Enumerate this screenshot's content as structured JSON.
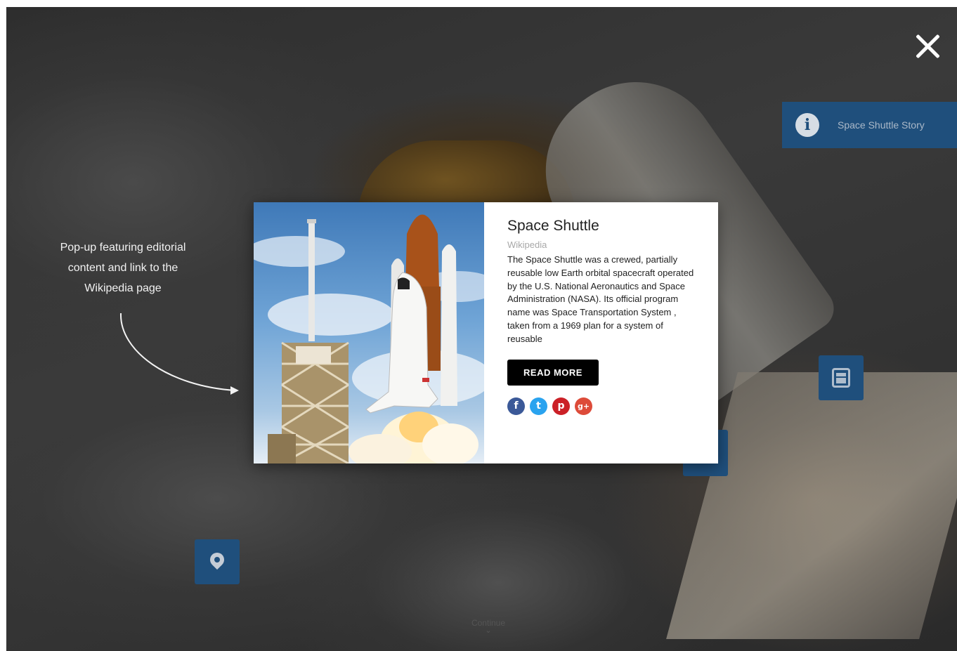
{
  "overlay": {
    "close_label": "×",
    "story_button_label": "Space Shuttle Story",
    "annotation_text": "Pop-up featuring editorial content and link to the Wikipedia page",
    "continue_label": "Continue",
    "continue_chevron": "⌄"
  },
  "popup": {
    "title": "Space Shuttle",
    "source": "Wikipedia",
    "description": "The Space Shuttle was a crewed, partially reusable low Earth orbital spacecraft operated by the U.S. National Aeronautics and Space Administration (NASA). Its official program name was Space Transportation System , taken from a 1969 plan for a system of reusable",
    "read_more_label": "READ MORE",
    "image_icon": "space-shuttle-launch-photo",
    "social": [
      {
        "name": "facebook",
        "glyph": "f",
        "color": "#3b5998"
      },
      {
        "name": "twitter",
        "glyph": "t",
        "color": "#2aa3ef"
      },
      {
        "name": "pinterest",
        "glyph": "p",
        "color": "#cb2027"
      },
      {
        "name": "google-plus",
        "glyph": "g+",
        "color": "#dd4b39"
      }
    ]
  },
  "icons": {
    "close": "close-icon",
    "info": "info-icon",
    "youtube": "youtube-icon",
    "location": "location-pin-icon"
  },
  "colors": {
    "hotspot_blue": "#1f4f7c",
    "button_black": "#000000"
  }
}
